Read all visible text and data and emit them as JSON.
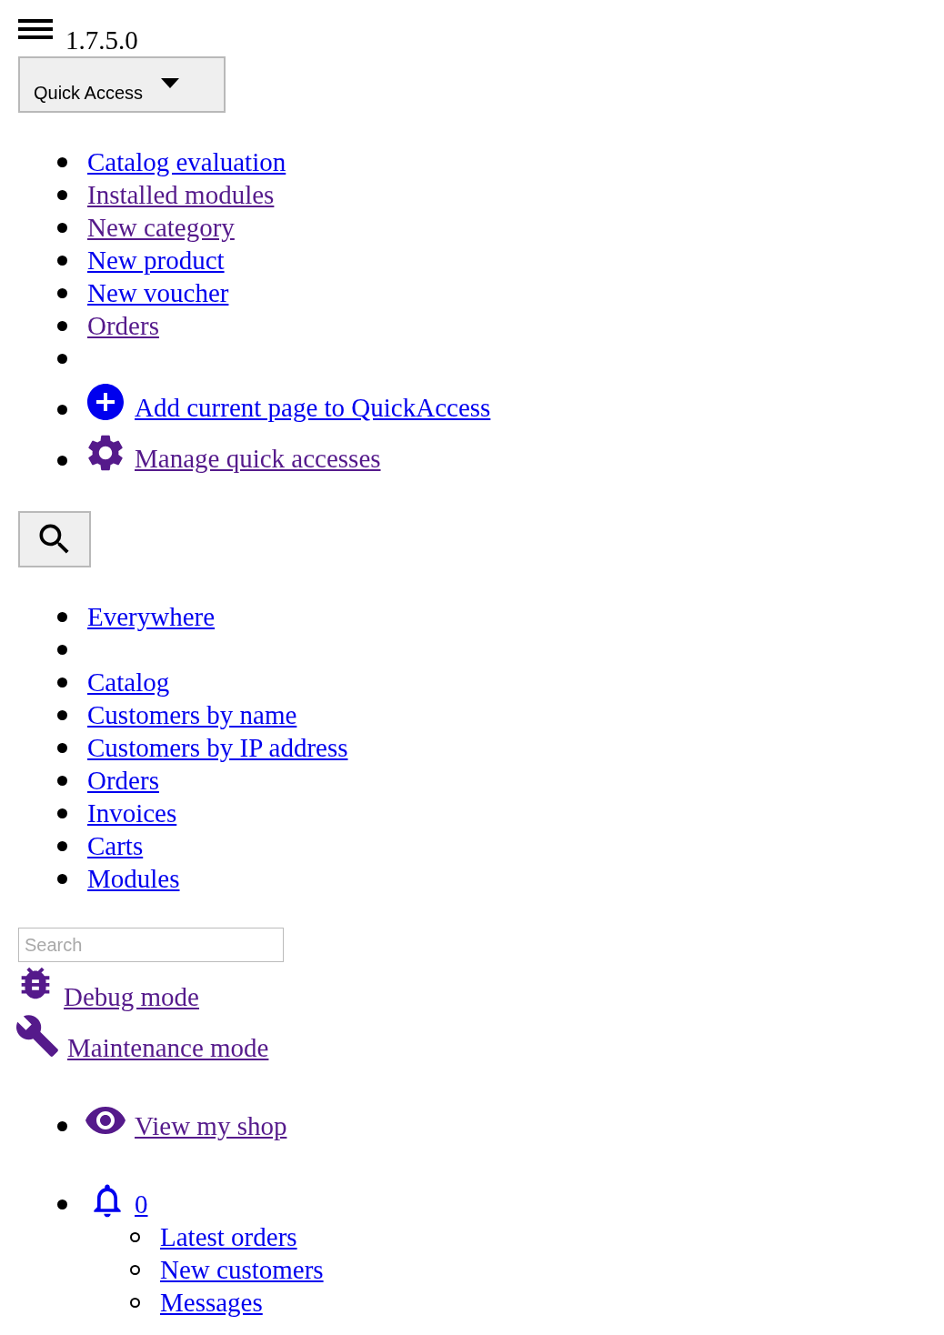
{
  "header": {
    "version": "1.7.5.0"
  },
  "quick_access": {
    "button": "Quick Access",
    "items": [
      {
        "kind": "link",
        "label": "Catalog evaluation",
        "visited": false
      },
      {
        "kind": "link",
        "label": "Installed modules",
        "visited": true
      },
      {
        "kind": "link",
        "label": "New category",
        "visited": true
      },
      {
        "kind": "link",
        "label": "New product",
        "visited": false
      },
      {
        "kind": "link",
        "label": "New voucher",
        "visited": false
      },
      {
        "kind": "link",
        "label": "Orders",
        "visited": true
      },
      {
        "kind": "empty"
      },
      {
        "kind": "add",
        "label": "Add current page to QuickAccess",
        "visited": false
      },
      {
        "kind": "manage",
        "label": "Manage quick accesses",
        "visited": true
      }
    ]
  },
  "search": {
    "scopes": [
      {
        "kind": "link",
        "label": "Everywhere",
        "visited": false
      },
      {
        "kind": "empty"
      },
      {
        "kind": "link",
        "label": "Catalog",
        "visited": false
      },
      {
        "kind": "link",
        "label": "Customers by name",
        "visited": false
      },
      {
        "kind": "link",
        "label": "Customers by IP address",
        "visited": false
      },
      {
        "kind": "link",
        "label": "Orders",
        "visited": false
      },
      {
        "kind": "link",
        "label": "Invoices",
        "visited": false
      },
      {
        "kind": "link",
        "label": "Carts",
        "visited": false
      },
      {
        "kind": "link",
        "label": "Modules",
        "visited": false
      }
    ],
    "placeholder": "Search"
  },
  "modes": [
    {
      "kind": "debug",
      "label": "Debug mode",
      "visited": true
    },
    {
      "kind": "maintenance",
      "label": "Maintenance mode",
      "visited": true
    }
  ],
  "shop_link": {
    "label": "View my shop",
    "visited": true
  },
  "notifications": {
    "count": "0",
    "visited": false,
    "children": [
      {
        "label": "Latest orders",
        "visited": false
      },
      {
        "label": "New customers",
        "visited": false
      },
      {
        "label": "Messages",
        "visited": false
      }
    ]
  }
}
